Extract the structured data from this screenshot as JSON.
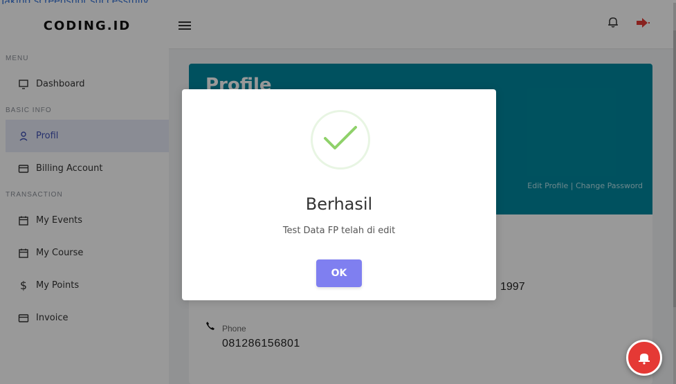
{
  "top_note": "Taking screenshot successfully",
  "brand": "CODING.ID",
  "sidebar": {
    "sections": [
      {
        "label": "MENU",
        "items": [
          {
            "label": "Dashboard",
            "icon": "monitor-icon"
          }
        ]
      },
      {
        "label": "BASIC INFO",
        "items": [
          {
            "label": "Profil",
            "icon": "user-icon",
            "active": true
          },
          {
            "label": "Billing Account",
            "icon": "card-icon"
          }
        ]
      },
      {
        "label": "TRANSACTION",
        "items": [
          {
            "label": "My Events",
            "icon": "calendar-icon"
          },
          {
            "label": "My Course",
            "icon": "calendar-icon"
          },
          {
            "label": "My Points",
            "icon": "dollar-icon"
          },
          {
            "label": "Invoice",
            "icon": "card-icon"
          }
        ]
      }
    ]
  },
  "header": {
    "bell_icon": "bell-icon",
    "logout_icon": "logout-icon"
  },
  "main": {
    "title": "Profile",
    "banner_links": {
      "edit": "Edit Profile",
      "separator": "|",
      "change_password": "Change Password"
    },
    "dob_value_partial": "1997",
    "phone_label": "Phone",
    "phone_value": "081286156801"
  },
  "modal": {
    "title": "Berhasil",
    "message": "Test Data FP telah di edit",
    "ok_label": "OK"
  },
  "colors": {
    "accent": "#3f51b5",
    "banner": "#00889e",
    "ok_button": "#7f7ff0",
    "fab": "#e53935"
  }
}
